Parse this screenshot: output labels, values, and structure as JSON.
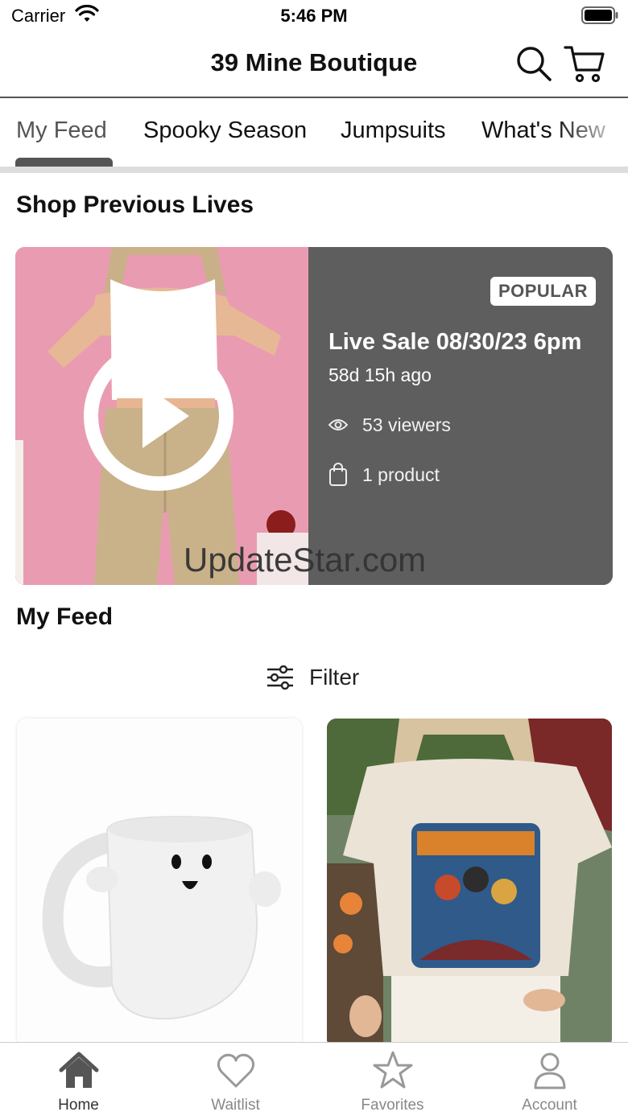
{
  "status_bar": {
    "carrier": "Carrier",
    "time": "5:46 PM"
  },
  "header": {
    "title": "39 Mine Boutique",
    "search_icon": "search-icon",
    "cart_icon": "cart-icon"
  },
  "tabs": [
    {
      "label": "My Feed",
      "active": true
    },
    {
      "label": "Spooky Season",
      "active": false
    },
    {
      "label": "Jumpsuits",
      "active": false
    },
    {
      "label": "What's New",
      "active": false
    }
  ],
  "previous_lives": {
    "title": "Shop Previous Lives",
    "card": {
      "badge": "POPULAR",
      "title": "Live Sale 08/30/23 6pm",
      "ago": "58d 15h ago",
      "viewers": "53 viewers",
      "products": "1 product",
      "play_icon": "play-icon",
      "viewers_icon": "eye-icon",
      "products_icon": "shopping-bag-icon"
    },
    "watermark": "UpdateStar.com"
  },
  "feed": {
    "title": "My Feed",
    "filter_label": "Filter",
    "filter_icon": "sliders-icon",
    "products": [
      {
        "image": "ghost-mug-image"
      },
      {
        "image": "graphic-tee-image"
      }
    ]
  },
  "bottom_nav": [
    {
      "label": "Home",
      "icon": "home-icon",
      "active": true
    },
    {
      "label": "Waitlist",
      "icon": "heart-icon",
      "active": false
    },
    {
      "label": "Favorites",
      "icon": "star-icon",
      "active": false
    },
    {
      "label": "Account",
      "icon": "user-icon",
      "active": false
    }
  ],
  "colors": {
    "accent": "#555555",
    "card_background": "#5e5e5e",
    "inactive_nav": "#888888"
  }
}
